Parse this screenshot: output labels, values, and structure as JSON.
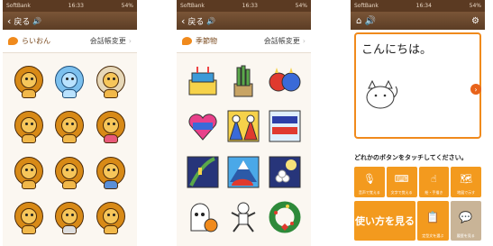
{
  "status": {
    "carrier": "SoftBank",
    "time_left": "16:33",
    "time_mid": "16:33",
    "time_right": "16:34",
    "battery": "54%"
  },
  "nav": {
    "back_label": "戻る"
  },
  "phone1": {
    "category": "らいおん",
    "change_label": "会話帳変更"
  },
  "phone2": {
    "category": "季節物",
    "change_label": "会話帳変更"
  },
  "phone3": {
    "greeting": "こんにちは。",
    "instruction": "どれかのボタンをタッチしてください。",
    "tools": [
      {
        "label": "音声で覚える",
        "icon": "microphone-icon"
      },
      {
        "label": "文字で覚える",
        "icon": "keyboard-icon"
      },
      {
        "label": "絵・手描き",
        "icon": "hand-draw-icon"
      },
      {
        "label": "地図で示す",
        "icon": "map-icon"
      }
    ],
    "howto_label": "使い方を見る",
    "bottom_buttons": [
      {
        "label": "定型文を選ぶ",
        "icon": "phrase-icon"
      },
      {
        "label": "履歴を見る",
        "icon": "history-icon"
      }
    ]
  },
  "colors": {
    "brown_bar": "#5c3d25",
    "orange": "#f39a1e",
    "accent": "#e8631a"
  }
}
